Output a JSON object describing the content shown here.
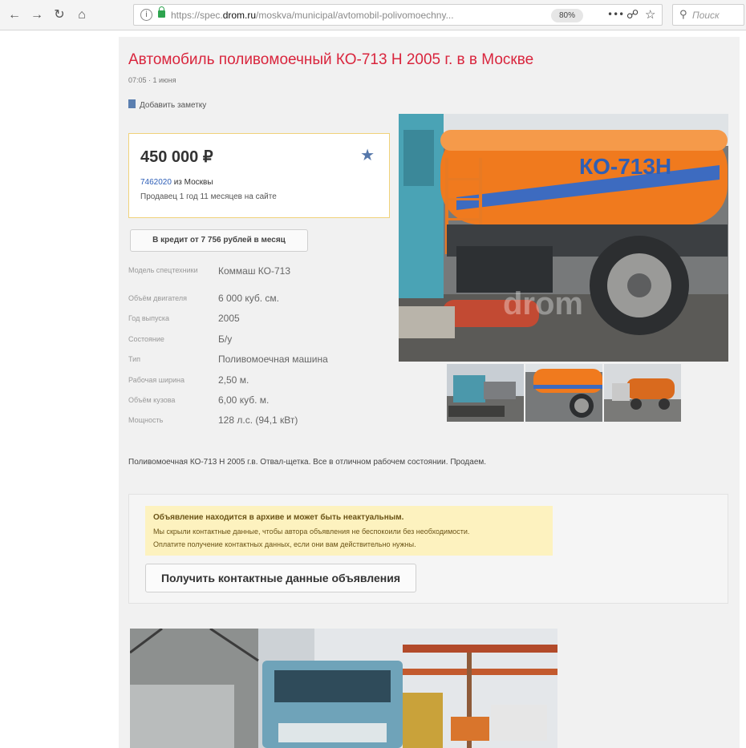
{
  "browser": {
    "url_prefix": "https://spec.",
    "url_domain": "drom.ru",
    "url_path": "/moskva/municipal/avtomobil-polivomoechny...",
    "zoom": "80%",
    "search_placeholder": "Поиск",
    "more_icon": "•••"
  },
  "listing": {
    "title": "Автомобиль поливомоечный КО-713 Н 2005 г. в в Москве",
    "meta": "07:05 · 1 июня",
    "add_note": "Добавить заметку",
    "price": "450 000 ₽",
    "seller_id": "7462020",
    "seller_city": " из Москвы",
    "seller_age": "Продавец 1 год 11 месяцев на сайте",
    "credit_button": "В кредит от 7 756 рублей в месяц",
    "specs": [
      {
        "label": "Модель спецтехники",
        "value": "Коммаш КО-713"
      },
      {
        "label": "Объём двигателя",
        "value": "6 000 куб. см."
      },
      {
        "label": "Год выпуска",
        "value": "2005"
      },
      {
        "label": "Состояние",
        "value": "Б/у"
      },
      {
        "label": "Тип",
        "value": "Поливомоечная машина"
      },
      {
        "label": "Рабочая ширина",
        "value": "2,50 м."
      },
      {
        "label": "Объём кузова",
        "value": "6,00 куб. м."
      },
      {
        "label": "Мощность",
        "value": "128 л.с. (94,1 кВт)"
      }
    ],
    "description": "Поливомоечная КО-713 Н 2005 г.в. Отвал-щетка. Все в отличном рабочем состоянии. Продаем."
  },
  "archive": {
    "title": "Объявление находится в архиве и может быть неактуальным.",
    "line1": "Мы скрыли контактные данные, чтобы автора объявления не беспокоили без необходимости.",
    "line2": "Оплатите получение контактных данных, если они вам действительно нужны.",
    "button": "Получить контактные данные объявления"
  },
  "photo": {
    "tank_lettering": "КО-713Н",
    "watermark": "drom"
  },
  "colors": {
    "title_red": "#d9253d",
    "link_blue": "#2c5db7",
    "warning_bg": "#fdf2bf",
    "tank_orange": "#f07a1e"
  }
}
